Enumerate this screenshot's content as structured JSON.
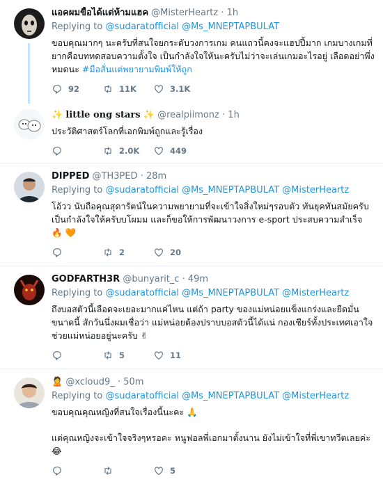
{
  "tweets": [
    {
      "name": "แอคผมขื้อได้แต่ห้ามแฮค",
      "handle": "@MisterHeartz",
      "time": "1h",
      "reply_prefix": "Replying to",
      "mentions": "@sudaratofficial @Ms_MNEPTAPBULAT",
      "text": "ขอบคุณมากๆ นะครับที่สนใจยกระดับวงการเกม คนแถวนี้คงจะแฮปปี้มาก เกมบางเกมที่ยากคือบททดสอบความตั้งใจ เป็นกำลังใจให้นะครับไม่ว่าจะเล่นเกมอะไรอยู่ เลือดอย่าพึ่งหมดนะ",
      "hashtag": "#มือสั่นแต่พยายามพิมพ์ให้ถูก",
      "replies": "92",
      "retweets": "11K",
      "likes": "3.1K"
    },
    {
      "name": "little ong stars",
      "handle": "@realpiimonz",
      "time": "1h",
      "text": "ประวัติศาสตร์โลกที่เอกพิมพ์ถูกและรู้เรื่อง",
      "replies": "",
      "retweets": "2.0K",
      "likes": "449"
    },
    {
      "name": "DIPPED",
      "handle": "@TH3PED",
      "time": "28m",
      "reply_prefix": "Replying to",
      "mentions": "@sudaratofficial @Ms_MNEPTAPBULAT @MisterHeartz",
      "text": "โอ้วว นับถือคุณสุดารัตน์ในความพยายามที่จะเข้าใจสิ่งใหม่ๆรอบตัว ทันยุคทันสมัยครับ เป็นกำลังใจให้ครับบโผมม และก็ขอให้การพัฒนาวงการ e-sport ประสบความสำเร็จ 🔥 🧡",
      "replies": "",
      "retweets": "2",
      "likes": "20"
    },
    {
      "name": "GODFARTH3R",
      "handle": "@bunyarit_c",
      "time": "49m",
      "reply_prefix": "Replying to",
      "mentions": "@sudaratofficial @Ms_MNEPTAPBULAT @MisterHeartz",
      "text": "ถึงบอสตัวนี้เลือดจะเยอะมากแค่ไหน แต่ถ้า party ของแม่หน่อยแข็งแกร่งและยืดมั่นขนาดนี้ สักวันนึ่งผมเชื่อว่า แม่หน่อยต้องปราบบอสตัวนี้ได้แน่ กองเชียร์ทั้งประเทศเอาใจช่วยแม่หน่อยอยู่นะครับ ✌",
      "replies": "",
      "retweets": "5",
      "likes": "11"
    },
    {
      "name": "🙎",
      "handle": "@xcloud9_",
      "time": "50m",
      "reply_prefix": "Replying to",
      "mentions": "@sudaratofficial @Ms_MNEPTAPBULAT @MisterHeartz",
      "text": "ขอบคุณคุณหญิงที่สนใจเรื่องนี้นะคะ 🙏",
      "text2": "แต่คุณหญิงจะเข้าใจจริงๆหรอคะ หนูฟอลพี่เอกมาตั้งนาน ยังไม่เข้าใจที่พี่เขาทวีตเลยค่ะ 😂",
      "replies": "",
      "retweets": "",
      "likes": "5"
    }
  ],
  "icons": {
    "reply": "reply-icon",
    "retweet": "retweet-icon",
    "like": "heart-icon"
  },
  "colors": {
    "link": "#1b95e0",
    "muted": "#657786",
    "thread": "#c4e4fa"
  }
}
